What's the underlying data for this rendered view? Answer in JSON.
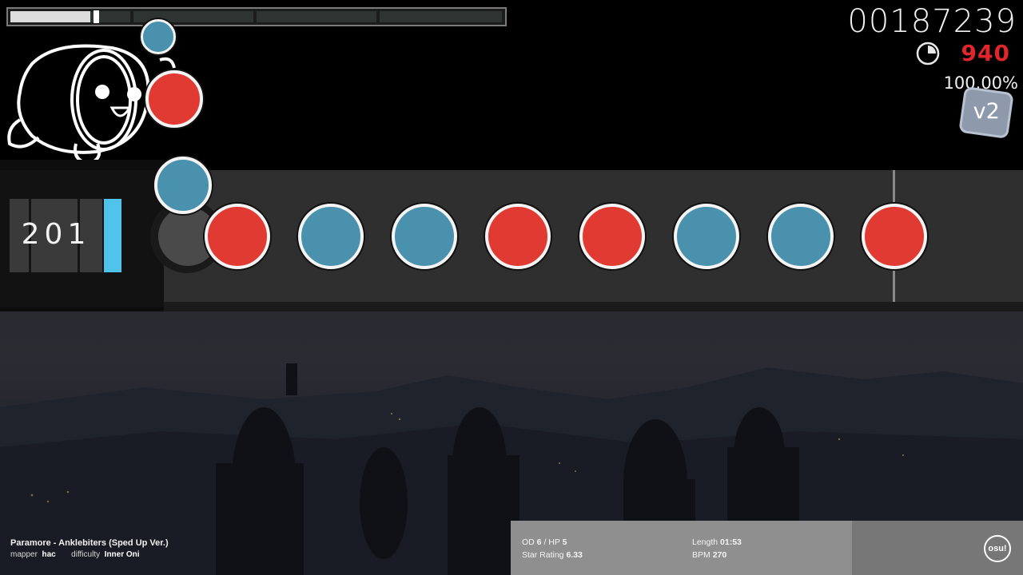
{
  "hud": {
    "score": "00187239",
    "combo_counter": "940",
    "accuracy": "100.00%",
    "mod_badge": "v2",
    "drum_combo": "201",
    "progress_fraction": 0.26
  },
  "notes": [
    {
      "color": "blue",
      "size": "small"
    },
    {
      "color": "red",
      "size": "medium"
    },
    {
      "color": "blue",
      "size": "medium"
    },
    {
      "color": "red",
      "size": "big"
    },
    {
      "color": "blue",
      "size": "big"
    },
    {
      "color": "blue",
      "size": "big"
    },
    {
      "color": "red",
      "size": "big"
    },
    {
      "color": "red",
      "size": "big"
    },
    {
      "color": "blue",
      "size": "big"
    },
    {
      "color": "blue",
      "size": "big"
    },
    {
      "color": "red",
      "size": "big"
    }
  ],
  "song": {
    "title": "Paramore - Anklebiters (Sped Up Ver.)",
    "mapper_label": "mapper",
    "mapper": "hac",
    "difficulty_label": "difficulty",
    "difficulty": "Inner Oni"
  },
  "stats": {
    "od_label": "OD",
    "od": "6",
    "hp_label": "/ HP",
    "hp": "5",
    "star_label": "Star Rating",
    "star": "6.33",
    "length_label": "Length",
    "length": "01:53",
    "bpm_label": "BPM",
    "bpm": "270"
  },
  "logo_text": "osu!",
  "colors": {
    "don": "#e13a33",
    "kat": "#4a91ad",
    "hp_bar": "#4fc3ea",
    "combo_red": "#e0262b"
  }
}
